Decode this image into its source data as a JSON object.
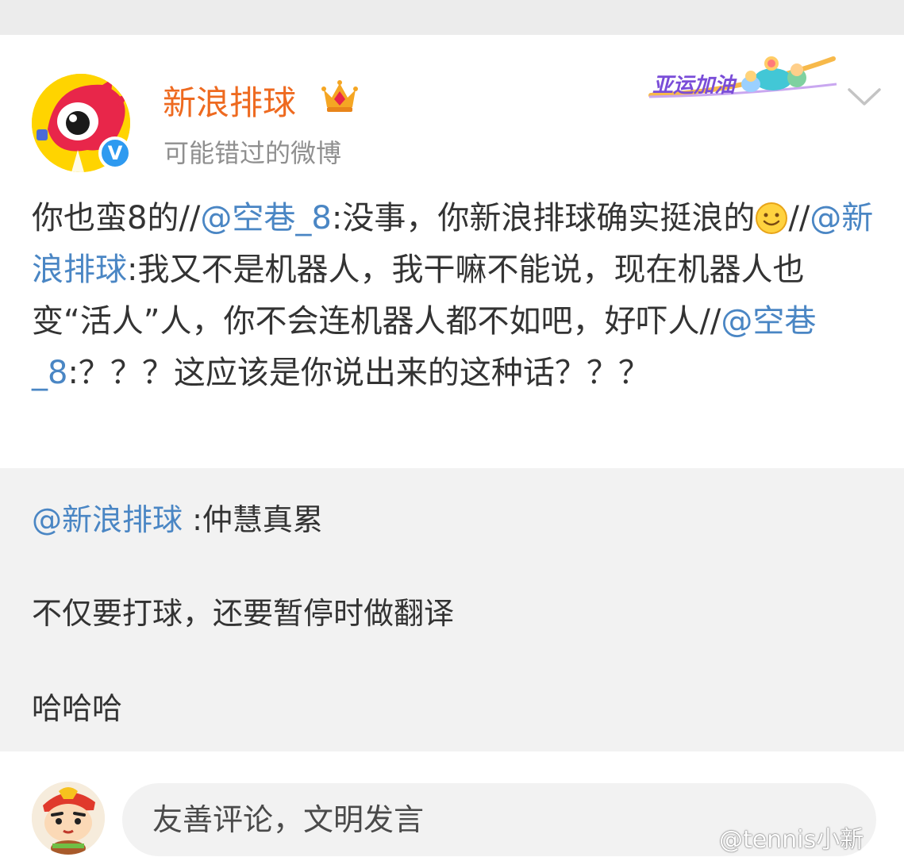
{
  "post": {
    "author": "新浪排球",
    "subtitle": "可能错过的微博",
    "badge_label": "亚运加油",
    "verified_mark": "V",
    "body": [
      {
        "t": "text",
        "v": "你也蛮8的//"
      },
      {
        "t": "mention",
        "v": "@空巷_8"
      },
      {
        "t": "text",
        "v": ":没事，你新浪排球确实挺浪的"
      },
      {
        "t": "emoji",
        "v": "smile"
      },
      {
        "t": "text",
        "v": "//"
      },
      {
        "t": "mention",
        "v": "@新浪排球"
      },
      {
        "t": "text",
        "v": ":我又不是机器人，我干嘛不能说，现在机器人也变“活人”人，你不会连机器人都不如吧，好吓人//"
      },
      {
        "t": "mention",
        "v": "@空巷_8"
      },
      {
        "t": "text",
        "v": ":？？？这应该是你说出来的这种话？？？"
      }
    ]
  },
  "repost": {
    "mention": "@新浪排球",
    "first_text": " :仲慧真累",
    "line2": "不仅要打球，还要暂停时做翻译",
    "line3": "哈哈哈"
  },
  "comment": {
    "placeholder": "友善评论，文明发言"
  },
  "watermark": "@tennis小新",
  "colors": {
    "author": "#ee6a20",
    "mention": "#4a86c4",
    "repost_bg": "#f2f2f2",
    "verified": "#2e9af0"
  }
}
